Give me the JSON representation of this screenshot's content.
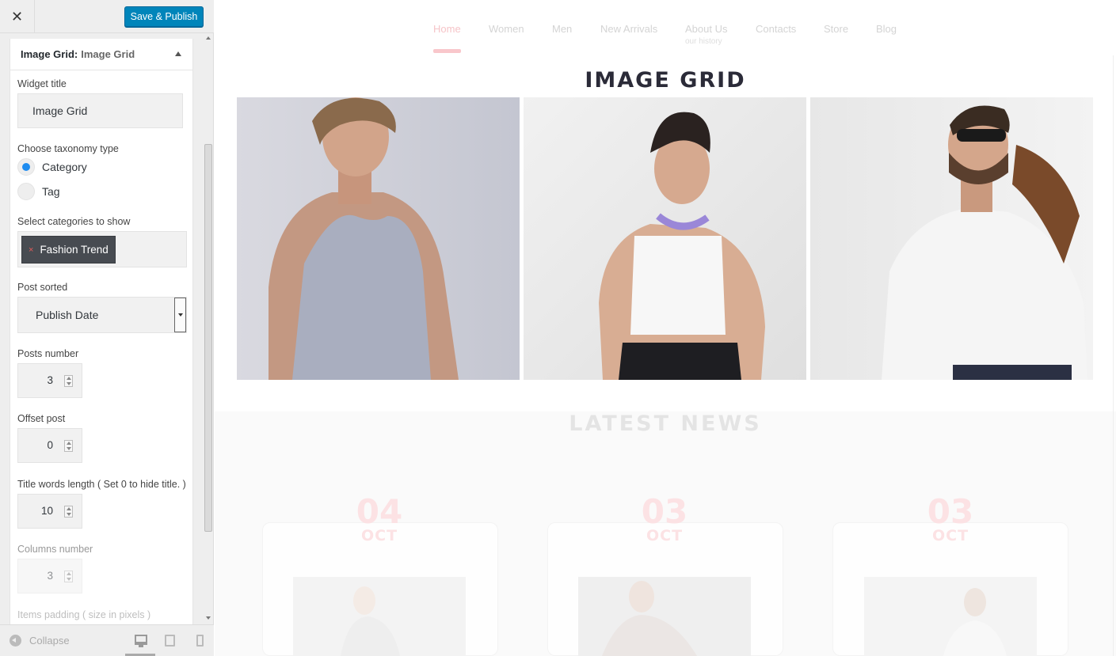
{
  "header": {
    "close_symbol": "✕",
    "save_label": "Save & Publish"
  },
  "widget": {
    "type_label": "Image Grid:",
    "name": "Image Grid",
    "fields": {
      "widget_title_label": "Widget title",
      "widget_title_value": "Image Grid",
      "taxonomy_label": "Choose taxonomy type",
      "taxonomy_options": [
        "Category",
        "Tag"
      ],
      "taxonomy_selected": "Category",
      "categories_label": "Select categories to show",
      "category_chip": "Fashion Trend",
      "chip_remove_symbol": "×",
      "post_sorted_label": "Post sorted",
      "post_sorted_value": "Publish Date",
      "posts_number_label": "Posts number",
      "posts_number_value": "3",
      "offset_label": "Offset post",
      "offset_value": "0",
      "title_words_label": "Title words length ( Set 0 to hide title. )",
      "title_words_value": "10",
      "columns_label": "Columns number",
      "columns_value": "3",
      "padding_label": "Items padding ( size in pixels )"
    }
  },
  "footer": {
    "collapse_label": "Collapse",
    "devices": [
      "desktop-icon",
      "tablet-icon",
      "mobile-icon"
    ]
  },
  "preview": {
    "nav": [
      {
        "label": "Home",
        "active": true
      },
      {
        "label": "Women"
      },
      {
        "label": "Men"
      },
      {
        "label": "New Arrivals"
      },
      {
        "label": "About Us",
        "sub": "our history"
      },
      {
        "label": "Contacts"
      },
      {
        "label": "Store"
      },
      {
        "label": "Blog"
      }
    ],
    "grid_title": "IMAGE GRID",
    "news_title": "LATEST NEWS",
    "news": [
      {
        "day": "04",
        "month": "OCT"
      },
      {
        "day": "03",
        "month": "OCT"
      },
      {
        "day": "03",
        "month": "OCT"
      }
    ],
    "accent_color": "#f9c7cb",
    "button_color": "#0085ba"
  }
}
